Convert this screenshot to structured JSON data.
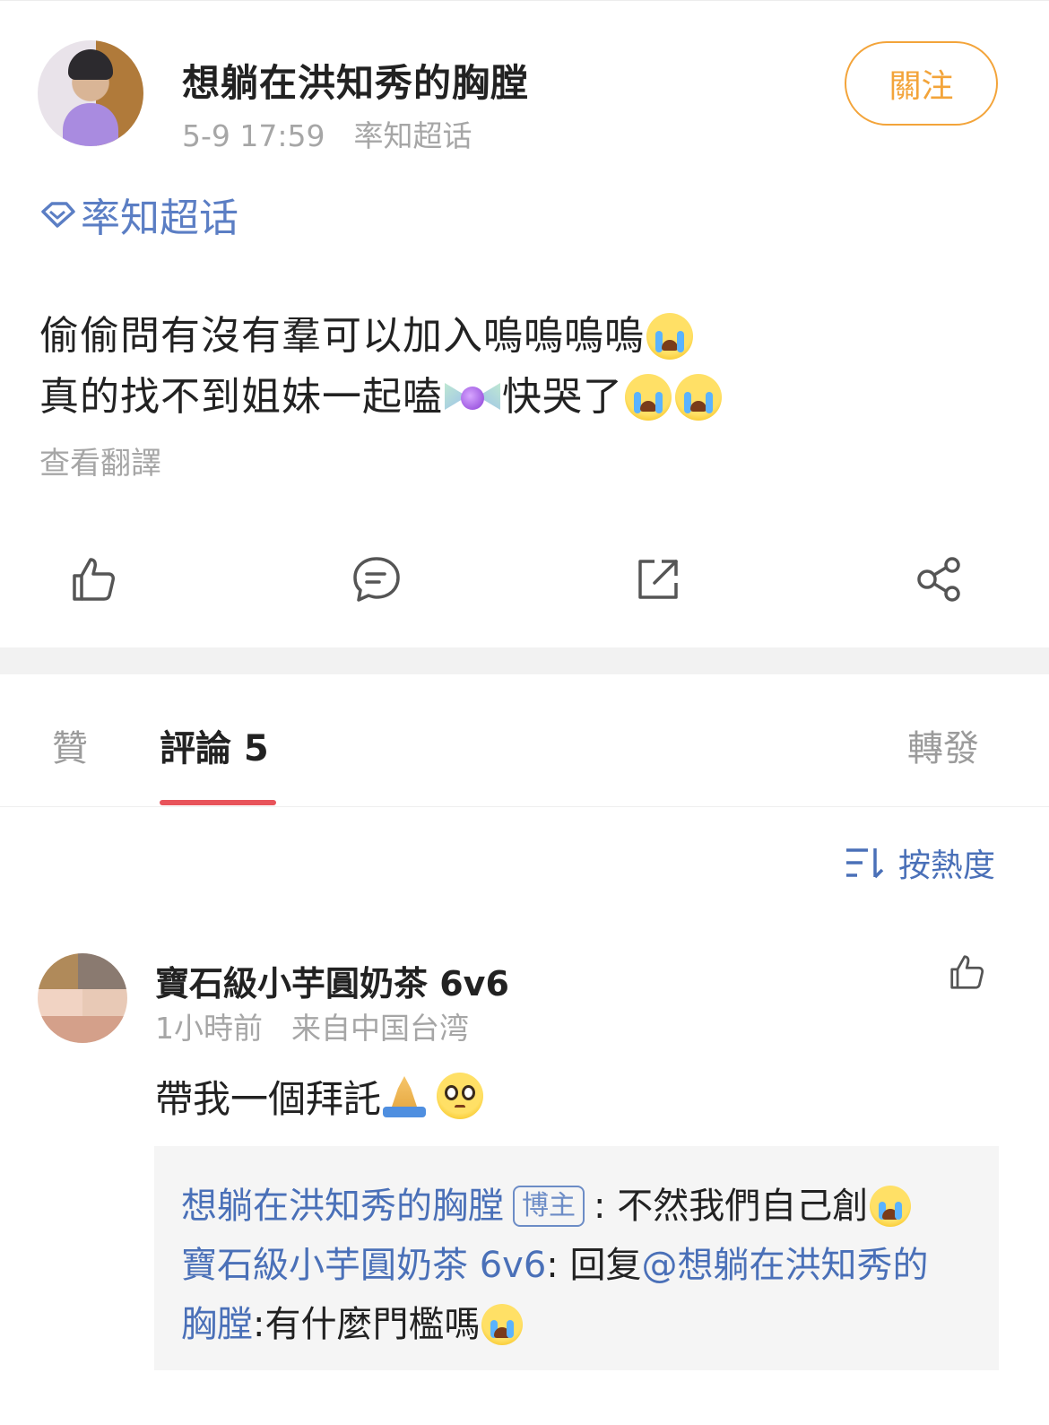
{
  "post": {
    "username": "想躺在洪知秀的胸膛",
    "time": "5-9 17:59",
    "source": "率知超话",
    "follow_label": "關注",
    "topic": "率知超话",
    "text_line1": "偷偷問有沒有羣可以加入嗚嗚嗚嗚",
    "text_line2a": "真的找不到姐妹一起嗑",
    "text_line2b": "快哭了",
    "translate_label": "查看翻譯",
    "actions": [
      "like-icon",
      "comment-icon",
      "repost-icon",
      "share-icon"
    ]
  },
  "tabs": {
    "likes": "贊",
    "comments": "評論 5",
    "reposts": "轉發"
  },
  "sort_label": "按熱度",
  "comment": {
    "username": "寶石級小芋圓奶茶 6v6",
    "time": "1小時前",
    "location": "来自中国台湾",
    "text": "帶我一個拜託"
  },
  "replies": {
    "r1_user": "想躺在洪知秀的胸膛",
    "r1_badge": "博主",
    "r1_text": ": 不然我們自己創",
    "r2_user": "寶石級小芋圓奶茶 6v6",
    "r2_sep": ": 回复 ",
    "r2_mention": "@想躺在洪知秀的",
    "r3_mention": "胸膛",
    "r3_text": ":有什麼門檻嗎"
  },
  "colors": {
    "accent_orange": "#f3a43a",
    "link_blue": "#4a70b8",
    "tab_underline": "#e8535a"
  }
}
